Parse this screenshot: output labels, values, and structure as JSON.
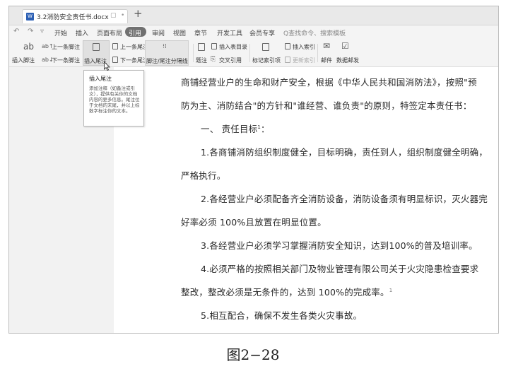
{
  "tab": {
    "icon": "W",
    "filename": "3.2消防安全责任书.docx",
    "controls": [
      "▢",
      "•"
    ],
    "new_tab": "+"
  },
  "quick_access": [
    "↶",
    "↷",
    "▿"
  ],
  "menu": [
    {
      "label": "开始"
    },
    {
      "label": "插入"
    },
    {
      "label": "页面布局"
    },
    {
      "label": "引用"
    },
    {
      "label": "审阅"
    },
    {
      "label": "视图"
    },
    {
      "label": "章节"
    },
    {
      "label": "开发工具"
    },
    {
      "label": "会员专享"
    },
    {
      "label": "Q查找命令、搜索模板"
    }
  ],
  "ribbon": {
    "insert_footnote": "插入脚注",
    "prev_footnote": "上一条脚注",
    "next_footnote": "下一条脚注",
    "insert_endnote": "插入尾注",
    "prev_endnote": "上一条尾注",
    "next_endnote": "下一条尾注",
    "separator": "脚注/尾注分隔线",
    "caption": "题注",
    "cross_ref": "交叉引用",
    "insert_table_of_figures": "插入表目录",
    "mark_index": "标记索引项",
    "insert_index": "插入索引",
    "update_index": "更新索引",
    "mail": "邮件",
    "data_merge": "数据邮发",
    "footnote_glyph": "ab"
  },
  "tooltip": {
    "title": "插入尾注",
    "body": "添加注释（如备注或引文），提供有关你的文档内容的更多信息。尾注位于文档的末尾，并以上标数字标注你的文本。"
  },
  "document": {
    "lines": [
      "商铺经营业户的生命和财产安全，根据《中华人民共和国消防法》，按照\"预",
      "防为主、消防结合\"的方针和\"谁经营、谁负责\"的原则，特签定本责任书：",
      "一、 责任目标",
      "1.各商铺消防组织制度健全，目标明确，责任到人，组织制度健全明确，",
      "严格执行。",
      "2.各经营业户必须配备齐全消防设备，消防设备须有明显标识，灭火器完",
      "好率必须 100%且放置在明显位置。",
      "3.各经营业户必须学习掌握消防安全知识，达到100%的普及培训率。",
      "4.必须严格的按照相关部门及物业管理有限公司关于火灾隐患检查要求",
      "整改，整改必须是无条件的，达到 100%的完成率。",
      "5.相互配合，确保不发生各类火灾事故。"
    ],
    "footnote_mark": "1",
    "endnote_mark": "1",
    "heading_suffix": "："
  },
  "caption": "图2−28"
}
